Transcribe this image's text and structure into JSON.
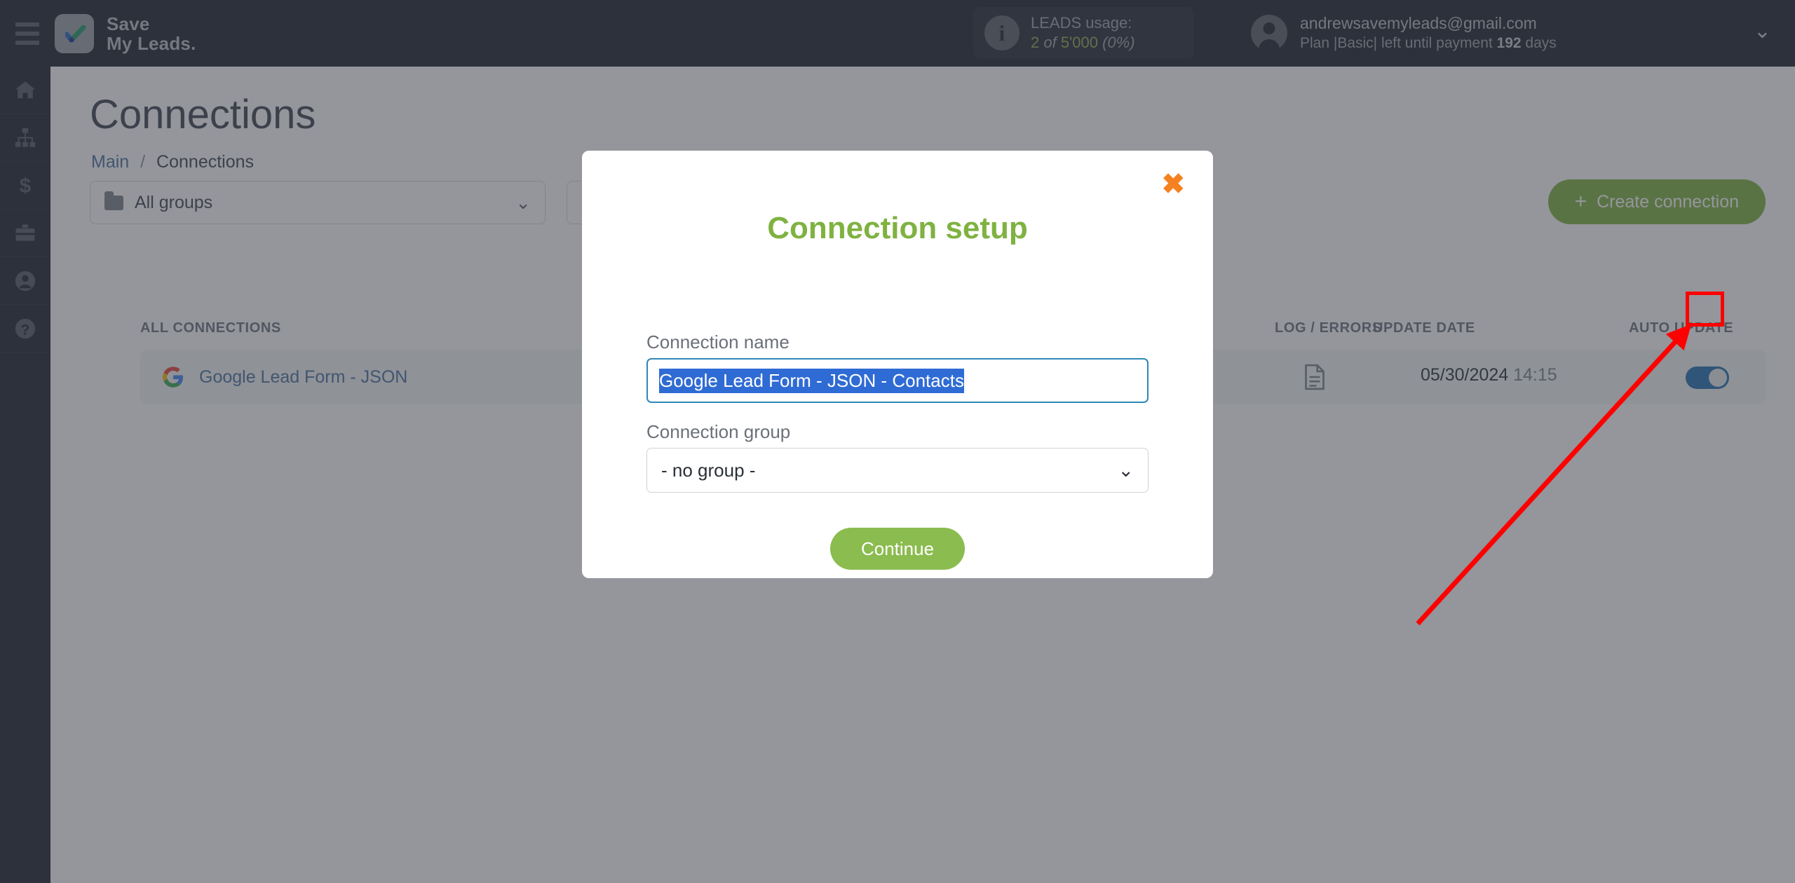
{
  "topbar": {
    "menu_icon": "hamburger-icon",
    "brand_line1": "Save",
    "brand_line2": "My Leads.",
    "leads": {
      "info_icon": "info-icon",
      "label": "LEADS usage:",
      "used": "2",
      "of": " of ",
      "total": "5'000",
      "percent": "(0%)"
    },
    "account": {
      "avatar_icon": "user-avatar-icon",
      "email": "andrewsavemyleads@gmail.com",
      "plan_prefix": "Plan |Basic| left until payment ",
      "plan_days": "192",
      "plan_suffix": " days",
      "caret_icon": "chevron-down-icon"
    }
  },
  "sidebar": {
    "items": [
      {
        "icon": "home-icon",
        "name": "sidebar-item-home"
      },
      {
        "icon": "sitemap-icon",
        "name": "sidebar-item-connections"
      },
      {
        "icon": "dollar-icon",
        "name": "sidebar-item-billing"
      },
      {
        "icon": "briefcase-icon",
        "name": "sidebar-item-business"
      },
      {
        "icon": "user-icon",
        "name": "sidebar-item-profile"
      },
      {
        "icon": "help-icon",
        "name": "sidebar-item-help"
      }
    ]
  },
  "page": {
    "title": "Connections",
    "breadcrumb": {
      "root": "Main",
      "separator": "/",
      "current": "Connections"
    },
    "groups_filter": {
      "folder_icon": "folder-icon",
      "value": "All groups",
      "caret": "chevron-down-icon"
    },
    "run_all": {
      "icon": "play-circle-icon"
    },
    "create_button": {
      "plus": "+",
      "label": "Create connection"
    },
    "table": {
      "headers": {
        "all_connections": "ALL CONNECTIONS",
        "log_errors": "LOG / ERRORS",
        "update_date": "UPDATE DATE",
        "auto_update": "AUTO UPDATE"
      },
      "rows": [
        {
          "source_icon": "google-icon",
          "name": "Google Lead Form - JSON",
          "log_icon": "document-icon",
          "update_date": "05/30/2024",
          "update_time": "14:15",
          "auto_update": "on",
          "actions": [
            "copy-icon",
            "gear-icon",
            "trash-icon"
          ]
        }
      ]
    }
  },
  "modal": {
    "close_icon": "close-icon",
    "title": "Connection setup",
    "name_label": "Connection name",
    "name_value": "Google Lead Form - JSON - Contacts",
    "group_label": "Connection group",
    "group_value": "- no group -",
    "group_caret": "chevron-down-icon",
    "continue_label": "Continue"
  },
  "annotation": {
    "highlight_target": "gear-icon",
    "highlight_color": "#ff0000",
    "arrow_color": "#ff0000"
  },
  "colors": {
    "topbar_bg": "#1b1f2a",
    "accent_green": "#7fb241",
    "accent_orange": "#f58220",
    "link_blue": "#4a6fa0",
    "toggle_blue": "#1f6fb2",
    "selection_blue": "#2f6bd4",
    "input_focus_border": "#2f88b6"
  }
}
